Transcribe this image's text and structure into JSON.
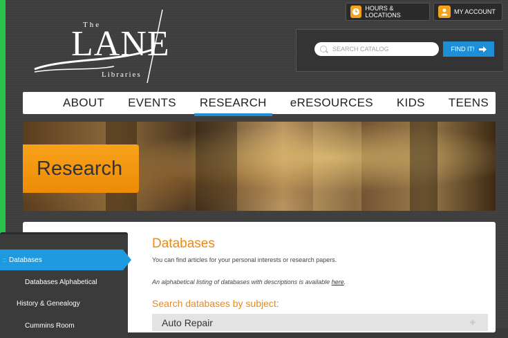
{
  "logo": {
    "the": "The",
    "lane": "LANE",
    "libraries": "Libraries"
  },
  "top_buttons": {
    "hours": "HOURS & LOCATIONS",
    "account": "MY ACCOUNT"
  },
  "search": {
    "placeholder": "SEARCH CATALOG",
    "button": "FIND IT!"
  },
  "nav": {
    "items": [
      "ABOUT",
      "EVENTS",
      "RESEARCH",
      "eRESOURCES",
      "KIDS",
      "TEENS"
    ],
    "active": "RESEARCH"
  },
  "banner": {
    "title": "Research"
  },
  "sidebar": {
    "items": [
      {
        "label": "Databases",
        "prefix": "::",
        "active": true
      },
      {
        "label": "Databases Alphabetical"
      },
      {
        "label": "History & Genealogy"
      },
      {
        "label": "Cummins Room"
      }
    ]
  },
  "main": {
    "heading": "Databases",
    "intro": "You can find articles for your personal interests or research papers.",
    "alpha_text": "An alphabetical listing of databases with descriptions is available ",
    "alpha_link": "here",
    "subject_heading": "Search databases by subject:",
    "accordion_first": "Auto Repair"
  },
  "colors": {
    "accent_orange": "#e8891a",
    "accent_blue": "#1d9ae0",
    "frame_green": "#2bc24a"
  }
}
